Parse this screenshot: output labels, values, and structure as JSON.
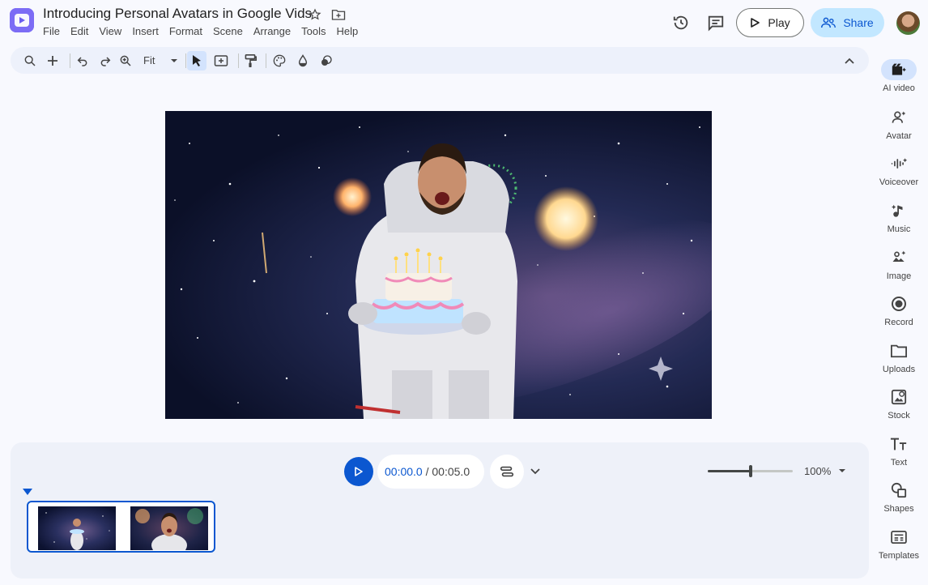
{
  "header": {
    "title": "Introducing Personal Avatars in Google Vids",
    "menu": [
      "File",
      "Edit",
      "View",
      "Insert",
      "Format",
      "Scene",
      "Arrange",
      "Tools",
      "Help"
    ],
    "play_label": "Play",
    "share_label": "Share"
  },
  "toolbar": {
    "zoom_fit_label": "Fit",
    "icons": [
      "search-icon",
      "add-icon",
      "undo-icon",
      "redo-icon",
      "zoom-icon",
      "select-icon",
      "add-text-box-icon",
      "paint-format-icon",
      "theme-palette-icon",
      "fill-color-icon",
      "effects-icon",
      "collapse-icon"
    ]
  },
  "rail": {
    "items": [
      {
        "label": "AI video",
        "icon": "ai-video-icon",
        "active": true
      },
      {
        "label": "Avatar",
        "icon": "avatar-icon"
      },
      {
        "label": "Voiceover",
        "icon": "voiceover-icon"
      },
      {
        "label": "Music",
        "icon": "music-icon"
      },
      {
        "label": "Image",
        "icon": "image-icon"
      },
      {
        "label": "Record",
        "icon": "record-icon"
      },
      {
        "label": "Uploads",
        "icon": "folder-icon"
      },
      {
        "label": "Stock",
        "icon": "stock-icon"
      },
      {
        "label": "Text",
        "icon": "text-icon"
      },
      {
        "label": "Shapes",
        "icon": "shapes-icon"
      },
      {
        "label": "Templates",
        "icon": "templates-icon"
      }
    ]
  },
  "timeline": {
    "current_time": "00:00.0",
    "separator": " / ",
    "total_time": "00:05.0",
    "zoom_label": "100%",
    "zoom_level": 0.5,
    "clips": [
      "scene-1",
      "scene-2"
    ]
  },
  "colors": {
    "accent": "#0b57d0",
    "share_bg": "#c2e7ff",
    "toolbar_bg": "#edf1fb"
  }
}
